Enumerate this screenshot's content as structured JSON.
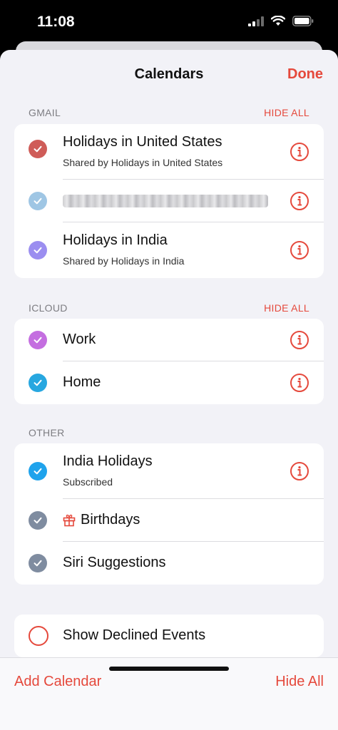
{
  "status": {
    "time": "11:08"
  },
  "nav": {
    "title": "Calendars",
    "done": "Done"
  },
  "colors": {
    "accent": "#e5493c"
  },
  "sections": {
    "gmail": {
      "title": "GMAIL",
      "hide_all": "HIDE ALL",
      "rows": [
        {
          "label": "Holidays in United States",
          "subtitle": "Shared by Holidays in United States",
          "color": "#cf5c58",
          "checked": true
        },
        {
          "label": "",
          "subtitle": "",
          "color": "#9fc6e4",
          "checked": true
        },
        {
          "label": "Holidays in India",
          "subtitle": "Shared by Holidays in India",
          "color": "#9b8ef0",
          "checked": true
        }
      ]
    },
    "icloud": {
      "title": "ICLOUD",
      "hide_all": "HIDE ALL",
      "rows": [
        {
          "label": "Work",
          "color": "#c46ee0",
          "checked": true
        },
        {
          "label": "Home",
          "color": "#27a7e0",
          "checked": true
        }
      ]
    },
    "other": {
      "title": "OTHER",
      "rows": [
        {
          "label": "India Holidays",
          "subtitle": "Subscribed",
          "color": "#1fa3ec",
          "checked": true
        },
        {
          "label": "Birthdays",
          "icon": "gift-icon",
          "color": "#7f8ca0",
          "checked": true
        },
        {
          "label": "Siri Suggestions",
          "color": "#7f8ca0",
          "checked": true
        }
      ]
    }
  },
  "declined": {
    "label": "Show Declined Events",
    "checked": false
  },
  "bottom": {
    "add_calendar": "Add Calendar",
    "hide_all": "Hide All"
  }
}
